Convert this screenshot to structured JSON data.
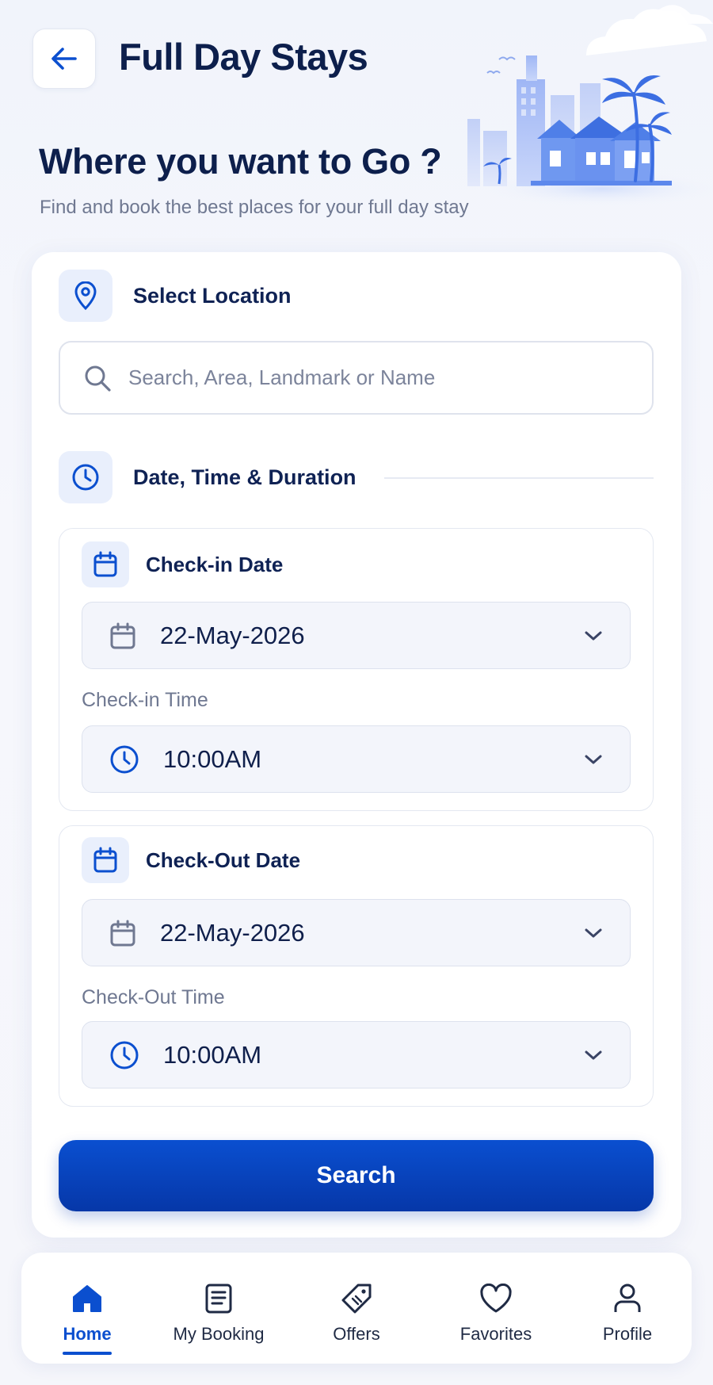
{
  "header": {
    "title": "Full Day Stays",
    "headline": "Where you want to Go ?",
    "subtitle": "Find and book the best places for your full day stay",
    "back_icon": "arrow-left-icon"
  },
  "location": {
    "section_title": "Select Location",
    "icon": "location-pin-icon",
    "search_placeholder": "Search, Area, Landmark or Name",
    "search_value": ""
  },
  "schedule": {
    "section_title": "Date, Time & Duration",
    "icon": "clock-icon",
    "checkin": {
      "date_label": "Check-in Date",
      "date_value": "22-May-2026",
      "time_label": "Check-in Time",
      "time_value": "10:00AM"
    },
    "checkout": {
      "date_label": "Check-Out Date",
      "date_value": "22-May-2026",
      "time_label": "Check-Out Time",
      "time_value": "10:00AM"
    }
  },
  "search_button_label": "Search",
  "nav": {
    "items": [
      {
        "label": "Home",
        "icon": "home-icon",
        "active": true
      },
      {
        "label": "My Booking",
        "icon": "document-list-icon",
        "active": false
      },
      {
        "label": "Offers",
        "icon": "tag-icon",
        "active": false
      },
      {
        "label": "Favorites",
        "icon": "heart-icon",
        "active": false
      },
      {
        "label": "Profile",
        "icon": "user-icon",
        "active": false
      }
    ]
  },
  "colors": {
    "primary": "#0b4fcf",
    "heading": "#0d1f4c",
    "muted": "#6f7891",
    "icon_tile": "#e9effc"
  }
}
